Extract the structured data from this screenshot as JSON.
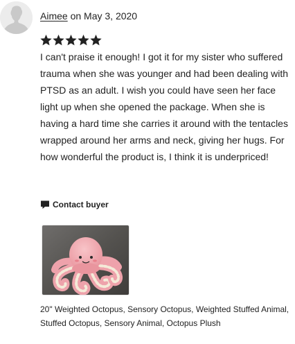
{
  "review": {
    "reviewer_name": "Aimee",
    "date_text": "on May 3, 2020",
    "rating": 5,
    "rating_max": 5,
    "text": "I can't praise it enough! I got it for my sister who suffered trauma when she was younger and had been dealing with PTSD as an adult. I wish you could have seen her face light up when she opened the package. When she is having a hard time she carries it around with the tentacles wrapped around her arms and neck, giving her hugs. For how wonderful the product is, I think it is underpriced!",
    "contact_label": "Contact buyer",
    "product_title": "20\" Weighted Octopus, Sensory Octopus, Weighted Stuffed Animal, Stuffed Octopus, Sensory Animal, Octopus Plush"
  },
  "icons": {
    "avatar": "default-user-avatar-icon",
    "star": "star-icon",
    "contact": "speech-bubble-icon"
  },
  "colors": {
    "text": "#222222",
    "star": "#222222",
    "avatar_bg": "#ececec",
    "avatar_figure": "#c9c9c9",
    "plush_pink": "#f2a9b1",
    "plush_cream": "#f4ead8"
  }
}
